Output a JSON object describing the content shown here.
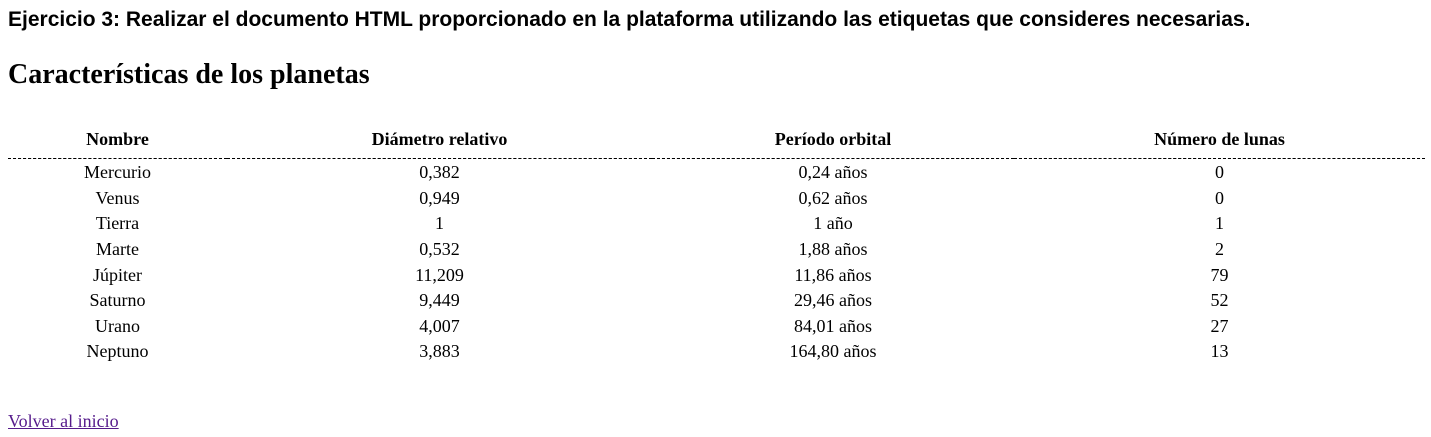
{
  "exercise_heading": "Ejercicio 3: Realizar el documento HTML proporcionado en la plataforma utilizando las etiquetas que consideres necesarias.",
  "page_title": "Características de los planetas",
  "table": {
    "headers": [
      "Nombre",
      "Diámetro relativo",
      "Período orbital",
      "Número de lunas"
    ],
    "rows": [
      [
        "Mercurio",
        "0,382",
        "0,24 años",
        "0"
      ],
      [
        "Venus",
        "0,949",
        "0,62 años",
        "0"
      ],
      [
        "Tierra",
        "1",
        "1 año",
        "1"
      ],
      [
        "Marte",
        "0,532",
        "1,88 años",
        "2"
      ],
      [
        "Júpiter",
        "11,209",
        "11,86 años",
        "79"
      ],
      [
        "Saturno",
        "9,449",
        "29,46 años",
        "52"
      ],
      [
        "Urano",
        "4,007",
        "84,01 años",
        "27"
      ],
      [
        "Neptuno",
        "3,883",
        "164,80 años",
        "13"
      ]
    ]
  },
  "home_link": {
    "label": "Volver al inicio",
    "color": "#551a8b"
  }
}
